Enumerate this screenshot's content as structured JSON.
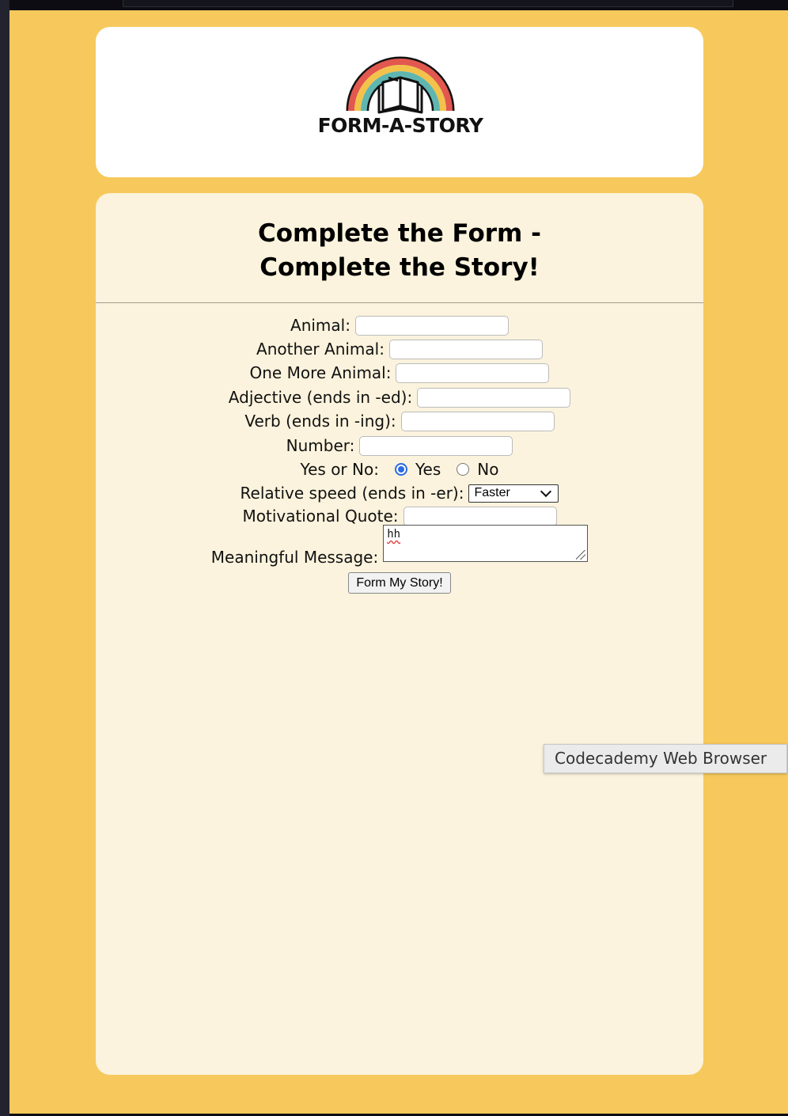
{
  "logo": {
    "text": "FORM-A-STORY"
  },
  "form": {
    "title_line1": "Complete the Form -",
    "title_line2": "Complete the Story!",
    "fields": {
      "animal": {
        "label": "Animal:",
        "value": ""
      },
      "another_animal": {
        "label": "Another Animal:",
        "value": ""
      },
      "one_more_animal": {
        "label": "One More Animal:",
        "value": ""
      },
      "adjective": {
        "label": "Adjective (ends in -ed):",
        "value": ""
      },
      "verb": {
        "label": "Verb (ends in -ing):",
        "value": ""
      },
      "number": {
        "label": "Number:",
        "value": ""
      },
      "yes_no": {
        "label": "Yes or No:",
        "yes_label": "Yes",
        "no_label": "No",
        "selected": "Yes"
      },
      "relative_speed": {
        "label": "Relative speed (ends in -er):",
        "value": "Faster"
      },
      "motivational_quote": {
        "label": "Motivational Quote:",
        "value": ""
      },
      "meaningful_message": {
        "label": "Meaningful Message:",
        "value": "hh"
      }
    },
    "submit_label": "Form My Story!"
  },
  "tooltip": {
    "text": "Codecademy Web Browser"
  },
  "colors": {
    "page_bg": "#f7c95c",
    "form_bg": "#fbf3dd",
    "header_bg": "#ffffff",
    "radio_accent": "#2a6be3"
  }
}
